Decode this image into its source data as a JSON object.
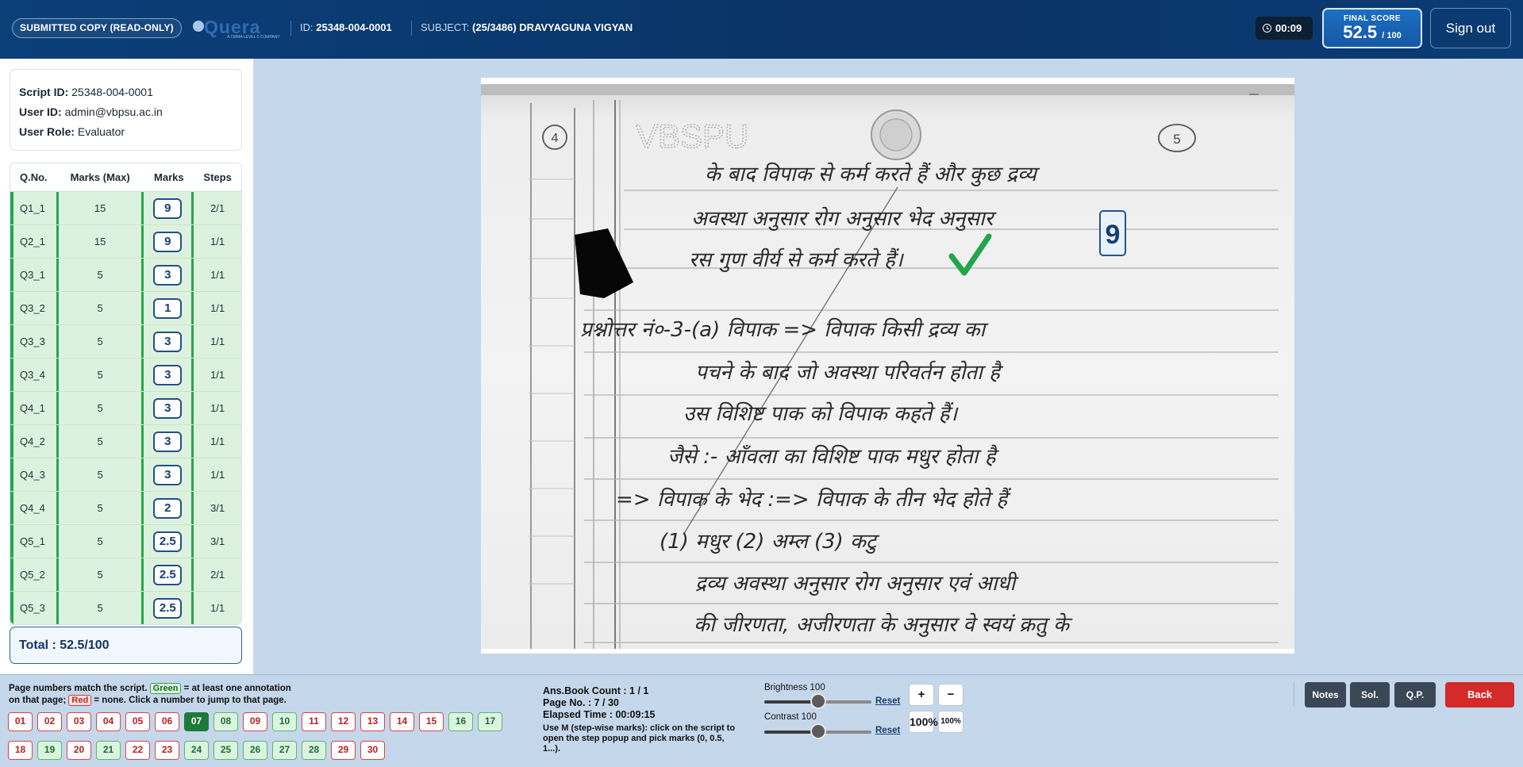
{
  "header": {
    "badge": "SUBMITTED COPY (READ-ONLY)",
    "logo_word": "Quera",
    "logo_sub": "A CMMA LEVEL 5 COMPANY",
    "id_label": "ID:",
    "id_value": "25348-004-0001",
    "subject_label": "SUBJECT:",
    "subject_value": "(25/3486) DRAVYAGUNA VIGYAN",
    "timer": "00:09",
    "final_score_label": "FINAL SCORE",
    "final_score_value": "52.5",
    "final_score_max": "/ 100",
    "signout": "Sign out"
  },
  "info": {
    "script_label": "Script ID:",
    "script_value": "25348-004-0001",
    "user_label": "User ID:",
    "user_value": "admin@vbpsu.ac.in",
    "role_label": "User Role:",
    "role_value": "Evaluator"
  },
  "table": {
    "headers": [
      "Q.No.",
      "Marks (Max)",
      "Marks",
      "Steps"
    ],
    "rows": [
      {
        "q": "Q1_1",
        "max": "15",
        "marks": "9",
        "steps": "2/1"
      },
      {
        "q": "Q2_1",
        "max": "15",
        "marks": "9",
        "steps": "1/1"
      },
      {
        "q": "Q3_1",
        "max": "5",
        "marks": "3",
        "steps": "1/1"
      },
      {
        "q": "Q3_2",
        "max": "5",
        "marks": "1",
        "steps": "1/1"
      },
      {
        "q": "Q3_3",
        "max": "5",
        "marks": "3",
        "steps": "1/1"
      },
      {
        "q": "Q3_4",
        "max": "5",
        "marks": "3",
        "steps": "1/1"
      },
      {
        "q": "Q4_1",
        "max": "5",
        "marks": "3",
        "steps": "1/1"
      },
      {
        "q": "Q4_2",
        "max": "5",
        "marks": "3",
        "steps": "1/1"
      },
      {
        "q": "Q4_3",
        "max": "5",
        "marks": "3",
        "steps": "1/1"
      },
      {
        "q": "Q4_4",
        "max": "5",
        "marks": "2",
        "steps": "3/1"
      },
      {
        "q": "Q5_1",
        "max": "5",
        "marks": "2.5",
        "steps": "3/1"
      },
      {
        "q": "Q5_2",
        "max": "5",
        "marks": "2.5",
        "steps": "2/1"
      },
      {
        "q": "Q5_3",
        "max": "5",
        "marks": "2.5",
        "steps": "1/1"
      }
    ],
    "total": "Total : 52.5/100"
  },
  "script_page": {
    "watermark": "VBSPU",
    "page_circle_left": "4",
    "page_circle_right": "5",
    "mark_stamp": "9",
    "lines": [
      "के बाद विपाक से कर्म करते हैं और कुछ द्रव्य",
      "अवस्था अनुसार रोग अनुसार भेद अनुसार",
      "रस गुण वीर्य से कर्म करते हैं।",
      "प्रश्नोत्तर नं०-3-(a) विपाक => विपाक किसी द्रव्य का",
      "पचने के बाद जो अवस्था परिवर्तन होता है",
      "उस विशिष्ट पाक को विपाक कहते हैं।",
      "जैसे :- आँवला का विशिष्ट पाक मधुर होता है",
      "=> विपाक के भेद :=> विपाक के तीन भेद होते हैं",
      "(1) मधुर (2) अम्ल (3) कटु",
      "द्रव्य अवस्था अनुसार रोग अनुसार एवं आधी",
      "की जीरणता, अजीरणता के अनुसार वे स्वयं क्रतु के"
    ]
  },
  "bottom": {
    "legend_a": "Page numbers match the script.",
    "legend_green": "Green",
    "legend_b": "= at least one annotation",
    "legend_c": "on that page;",
    "legend_red": "Red",
    "legend_d": "= none. Click a number to jump to that page.",
    "pages": [
      {
        "n": "01",
        "s": "red"
      },
      {
        "n": "02",
        "s": "red"
      },
      {
        "n": "03",
        "s": "red"
      },
      {
        "n": "04",
        "s": "red"
      },
      {
        "n": "05",
        "s": "red"
      },
      {
        "n": "06",
        "s": "red"
      },
      {
        "n": "07",
        "s": "active"
      },
      {
        "n": "08",
        "s": "green"
      },
      {
        "n": "09",
        "s": "red"
      },
      {
        "n": "10",
        "s": "green"
      },
      {
        "n": "11",
        "s": "red"
      },
      {
        "n": "12",
        "s": "red"
      },
      {
        "n": "13",
        "s": "red"
      },
      {
        "n": "14",
        "s": "red"
      },
      {
        "n": "15",
        "s": "red"
      },
      {
        "n": "16",
        "s": "green"
      },
      {
        "n": "17",
        "s": "green"
      },
      {
        "n": "18",
        "s": "red"
      },
      {
        "n": "19",
        "s": "green"
      },
      {
        "n": "20",
        "s": "red"
      },
      {
        "n": "21",
        "s": "green"
      },
      {
        "n": "22",
        "s": "red"
      },
      {
        "n": "23",
        "s": "red"
      },
      {
        "n": "24",
        "s": "green"
      },
      {
        "n": "25",
        "s": "green"
      },
      {
        "n": "26",
        "s": "green"
      },
      {
        "n": "27",
        "s": "green"
      },
      {
        "n": "28",
        "s": "green"
      },
      {
        "n": "29",
        "s": "red"
      },
      {
        "n": "30",
        "s": "red"
      }
    ],
    "ans_book": "Ans.Book Count : 1 / 1",
    "page_no": "Page No. : 7 / 30",
    "elapsed": "Elapsed Time : 00:09:15",
    "hint": "Use M (step-wise marks): click on the script to open the step popup and pick marks (0, 0.5, 1...).",
    "brightness_label": "Brightness 100",
    "brightness": 100,
    "contrast_label": "Contrast 100",
    "contrast": 100,
    "reset": "Reset",
    "zoom_in": "+",
    "zoom_out": "−",
    "zoom_main": "100%",
    "zoom_small": "100%",
    "notes": "Notes",
    "sol": "Sol.",
    "qp": "Q.P.",
    "back": "Back"
  },
  "colors": {
    "header_bg": "#0a3366",
    "annotated_green": "#27a84b",
    "unannotated_red": "#d94444",
    "active_page": "#1e7a3a",
    "back_button": "#d32a2a"
  }
}
